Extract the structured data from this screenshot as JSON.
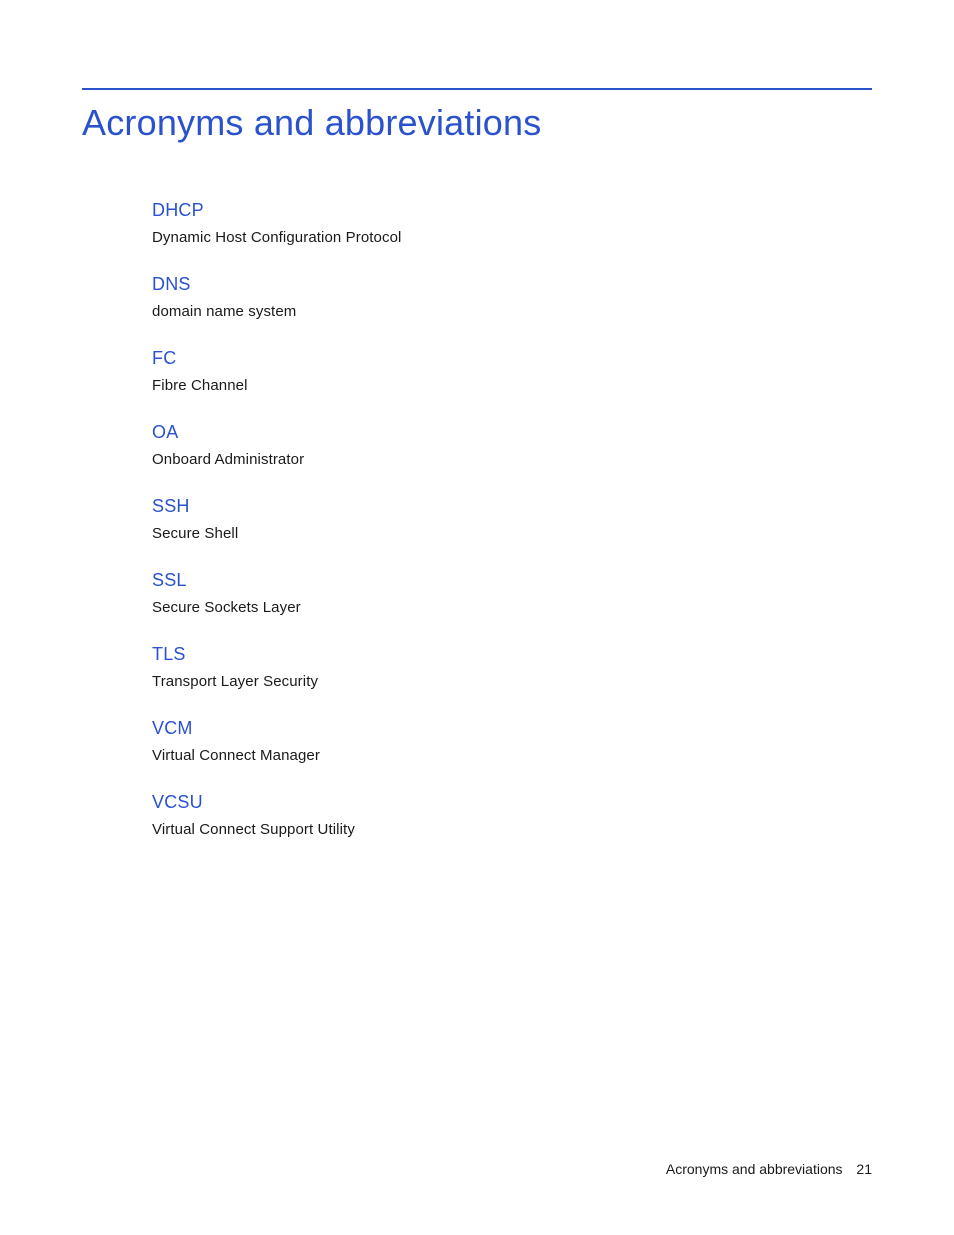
{
  "title": "Acronyms and abbreviations",
  "entries": [
    {
      "term": "DHCP",
      "definition": "Dynamic Host Configuration Protocol"
    },
    {
      "term": "DNS",
      "definition": "domain name system"
    },
    {
      "term": "FC",
      "definition": "Fibre Channel"
    },
    {
      "term": "OA",
      "definition": "Onboard Administrator"
    },
    {
      "term": "SSH",
      "definition": "Secure Shell"
    },
    {
      "term": "SSL",
      "definition": "Secure Sockets Layer"
    },
    {
      "term": "TLS",
      "definition": "Transport Layer Security"
    },
    {
      "term": "VCM",
      "definition": "Virtual Connect Manager"
    },
    {
      "term": "VCSU",
      "definition": "Virtual Connect Support Utility"
    }
  ],
  "footer": {
    "label": "Acronyms and abbreviations",
    "page": "21"
  }
}
